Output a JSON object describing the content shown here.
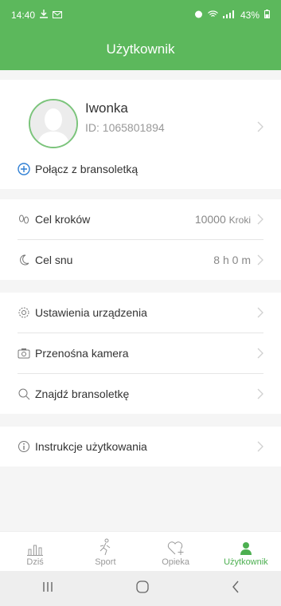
{
  "status_bar": {
    "time": "14:40",
    "battery": "43%"
  },
  "header": {
    "title": "Użytkownik"
  },
  "profile": {
    "name": "Iwonka",
    "id_text": "ID: 1065801894"
  },
  "connect": {
    "label": "Połącz z bransoletką"
  },
  "goals": {
    "steps_label": "Cel kroków",
    "steps_value": "10000",
    "steps_unit": "Kroki",
    "sleep_label": "Cel snu",
    "sleep_value": "8 h 0 m"
  },
  "device": {
    "settings_label": "Ustawienia urządzenia",
    "camera_label": "Przenośna kamera",
    "find_label": "Znajdź bransoletkę"
  },
  "help": {
    "instructions_label": "Instrukcje użytkowania"
  },
  "tabs": [
    {
      "label": "Dziś",
      "icon": "bars-icon"
    },
    {
      "label": "Sport",
      "icon": "runner-icon"
    },
    {
      "label": "Opieka",
      "icon": "heart-plus-icon"
    },
    {
      "label": "Użytkownik",
      "icon": "person-icon"
    }
  ],
  "colors": {
    "accent": "#5cb85c",
    "active_tab": "#4caf50"
  }
}
